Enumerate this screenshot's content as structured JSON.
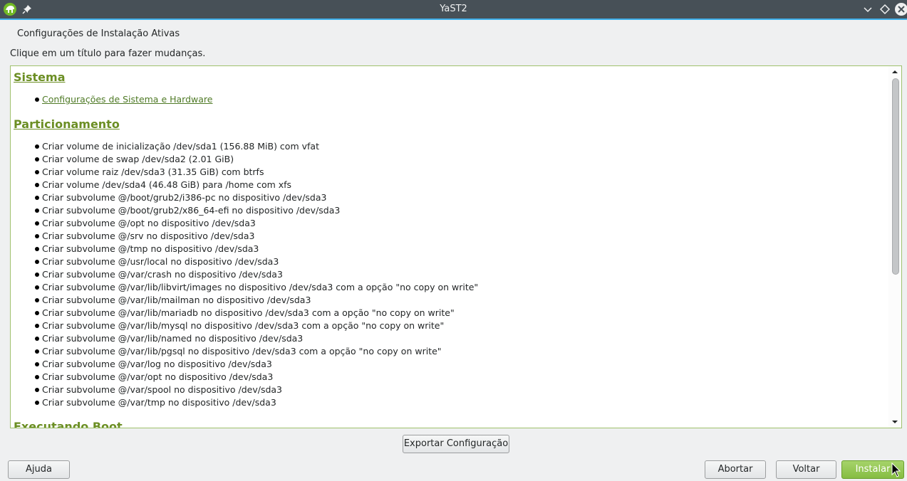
{
  "window": {
    "title": "YaST2",
    "app_icon": "opensuse-chameleon-icon",
    "controls": [
      "pin-icon",
      "minimize-chevron-icon",
      "maximize-diamond-icon",
      "close-icon"
    ]
  },
  "page": {
    "heading": "Configurações de Instalação Ativas",
    "hint": "Clique em um título para fazer mudanças."
  },
  "overview": {
    "sections": [
      {
        "title": "Sistema",
        "items": [
          "Configurações de Sistema e Hardware"
        ]
      },
      {
        "title": "Particionamento",
        "items": [
          "Criar volume de inicialização /dev/sda1 (156.88 MiB) com vfat",
          "Criar volume de swap /dev/sda2 (2.01 GiB)",
          "Criar volume raiz /dev/sda3 (31.35 GiB) com btrfs",
          "Criar volume /dev/sda4 (46.48 GiB) para /home com xfs",
          "Criar subvolume @/boot/grub2/i386-pc no dispositivo /dev/sda3",
          "Criar subvolume @/boot/grub2/x86_64-efi no dispositivo /dev/sda3",
          "Criar subvolume @/opt no dispositivo /dev/sda3",
          "Criar subvolume @/srv no dispositivo /dev/sda3",
          "Criar subvolume @/tmp no dispositivo /dev/sda3",
          "Criar subvolume @/usr/local no dispositivo /dev/sda3",
          "Criar subvolume @/var/crash no dispositivo /dev/sda3",
          "Criar subvolume @/var/lib/libvirt/images no dispositivo /dev/sda3 com a opção \"no copy on write\"",
          "Criar subvolume @/var/lib/mailman no dispositivo /dev/sda3",
          "Criar subvolume @/var/lib/mariadb no dispositivo /dev/sda3 com a opção \"no copy on write\"",
          "Criar subvolume @/var/lib/mysql no dispositivo /dev/sda3 com a opção \"no copy on write\"",
          "Criar subvolume @/var/lib/named no dispositivo /dev/sda3",
          "Criar subvolume @/var/lib/pgsql no dispositivo /dev/sda3 com a opção \"no copy on write\"",
          "Criar subvolume @/var/log no dispositivo /dev/sda3",
          "Criar subvolume @/var/opt no dispositivo /dev/sda3",
          "Criar subvolume @/var/spool no dispositivo /dev/sda3",
          "Criar subvolume @/var/tmp no dispositivo /dev/sda3"
        ]
      },
      {
        "title": "Executando Boot",
        "items": []
      }
    ]
  },
  "buttons": {
    "export": "Exportar Configuração",
    "help": "Ajuda",
    "abort": "Abortar",
    "back": "Voltar",
    "install": "Instalar"
  },
  "colors": {
    "titlebar": "#475057",
    "accent": "#3daee9",
    "section_title": "#6b8e23",
    "install_button": "#86bd42"
  }
}
